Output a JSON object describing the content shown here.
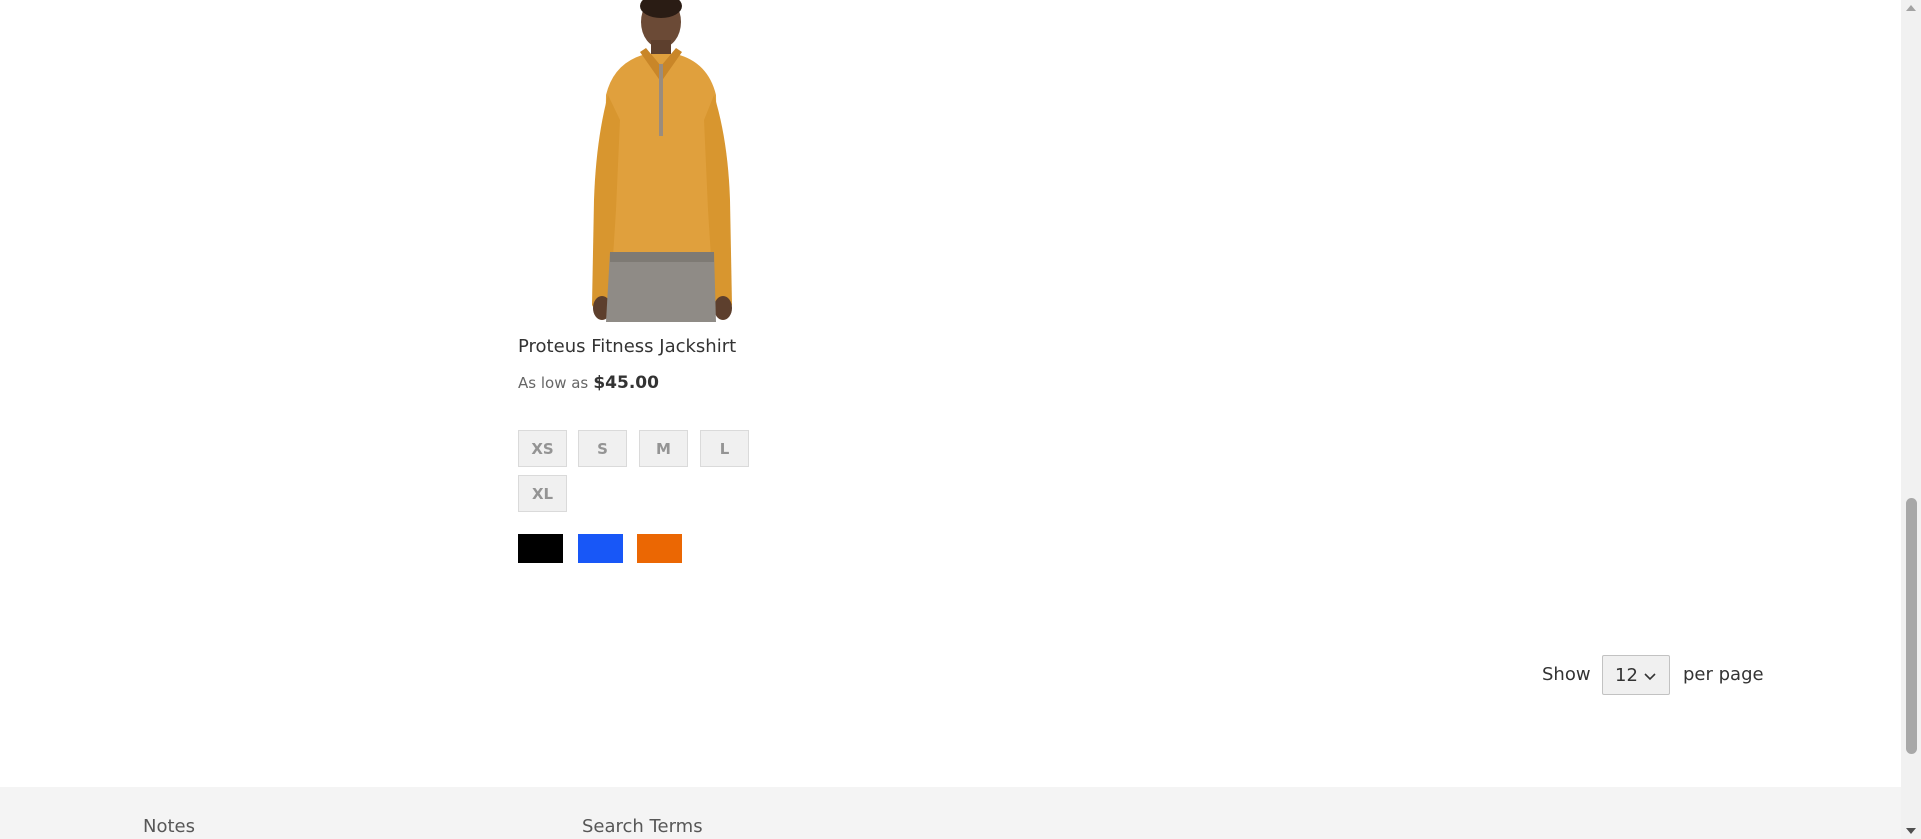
{
  "product": {
    "name": "Proteus Fitness Jackshirt",
    "price_prefix": "As low as",
    "price": "$45.00",
    "image_alt": "orange fitness jackshirt on model",
    "sizes": [
      "XS",
      "S",
      "M",
      "L",
      "XL"
    ],
    "colors": [
      {
        "name": "Black",
        "hex": "#000000"
      },
      {
        "name": "Blue",
        "hex": "#1857f7"
      },
      {
        "name": "Orange",
        "hex": "#eb6703"
      }
    ]
  },
  "toolbar": {
    "show_label": "Show",
    "limiter_value": "12",
    "per_page_label": "per page"
  },
  "footer": {
    "links": [
      "Notes",
      "Search Terms"
    ]
  },
  "scrollbar": {
    "up_icon": "arrow-up-icon",
    "down_icon": "arrow-down-icon"
  }
}
